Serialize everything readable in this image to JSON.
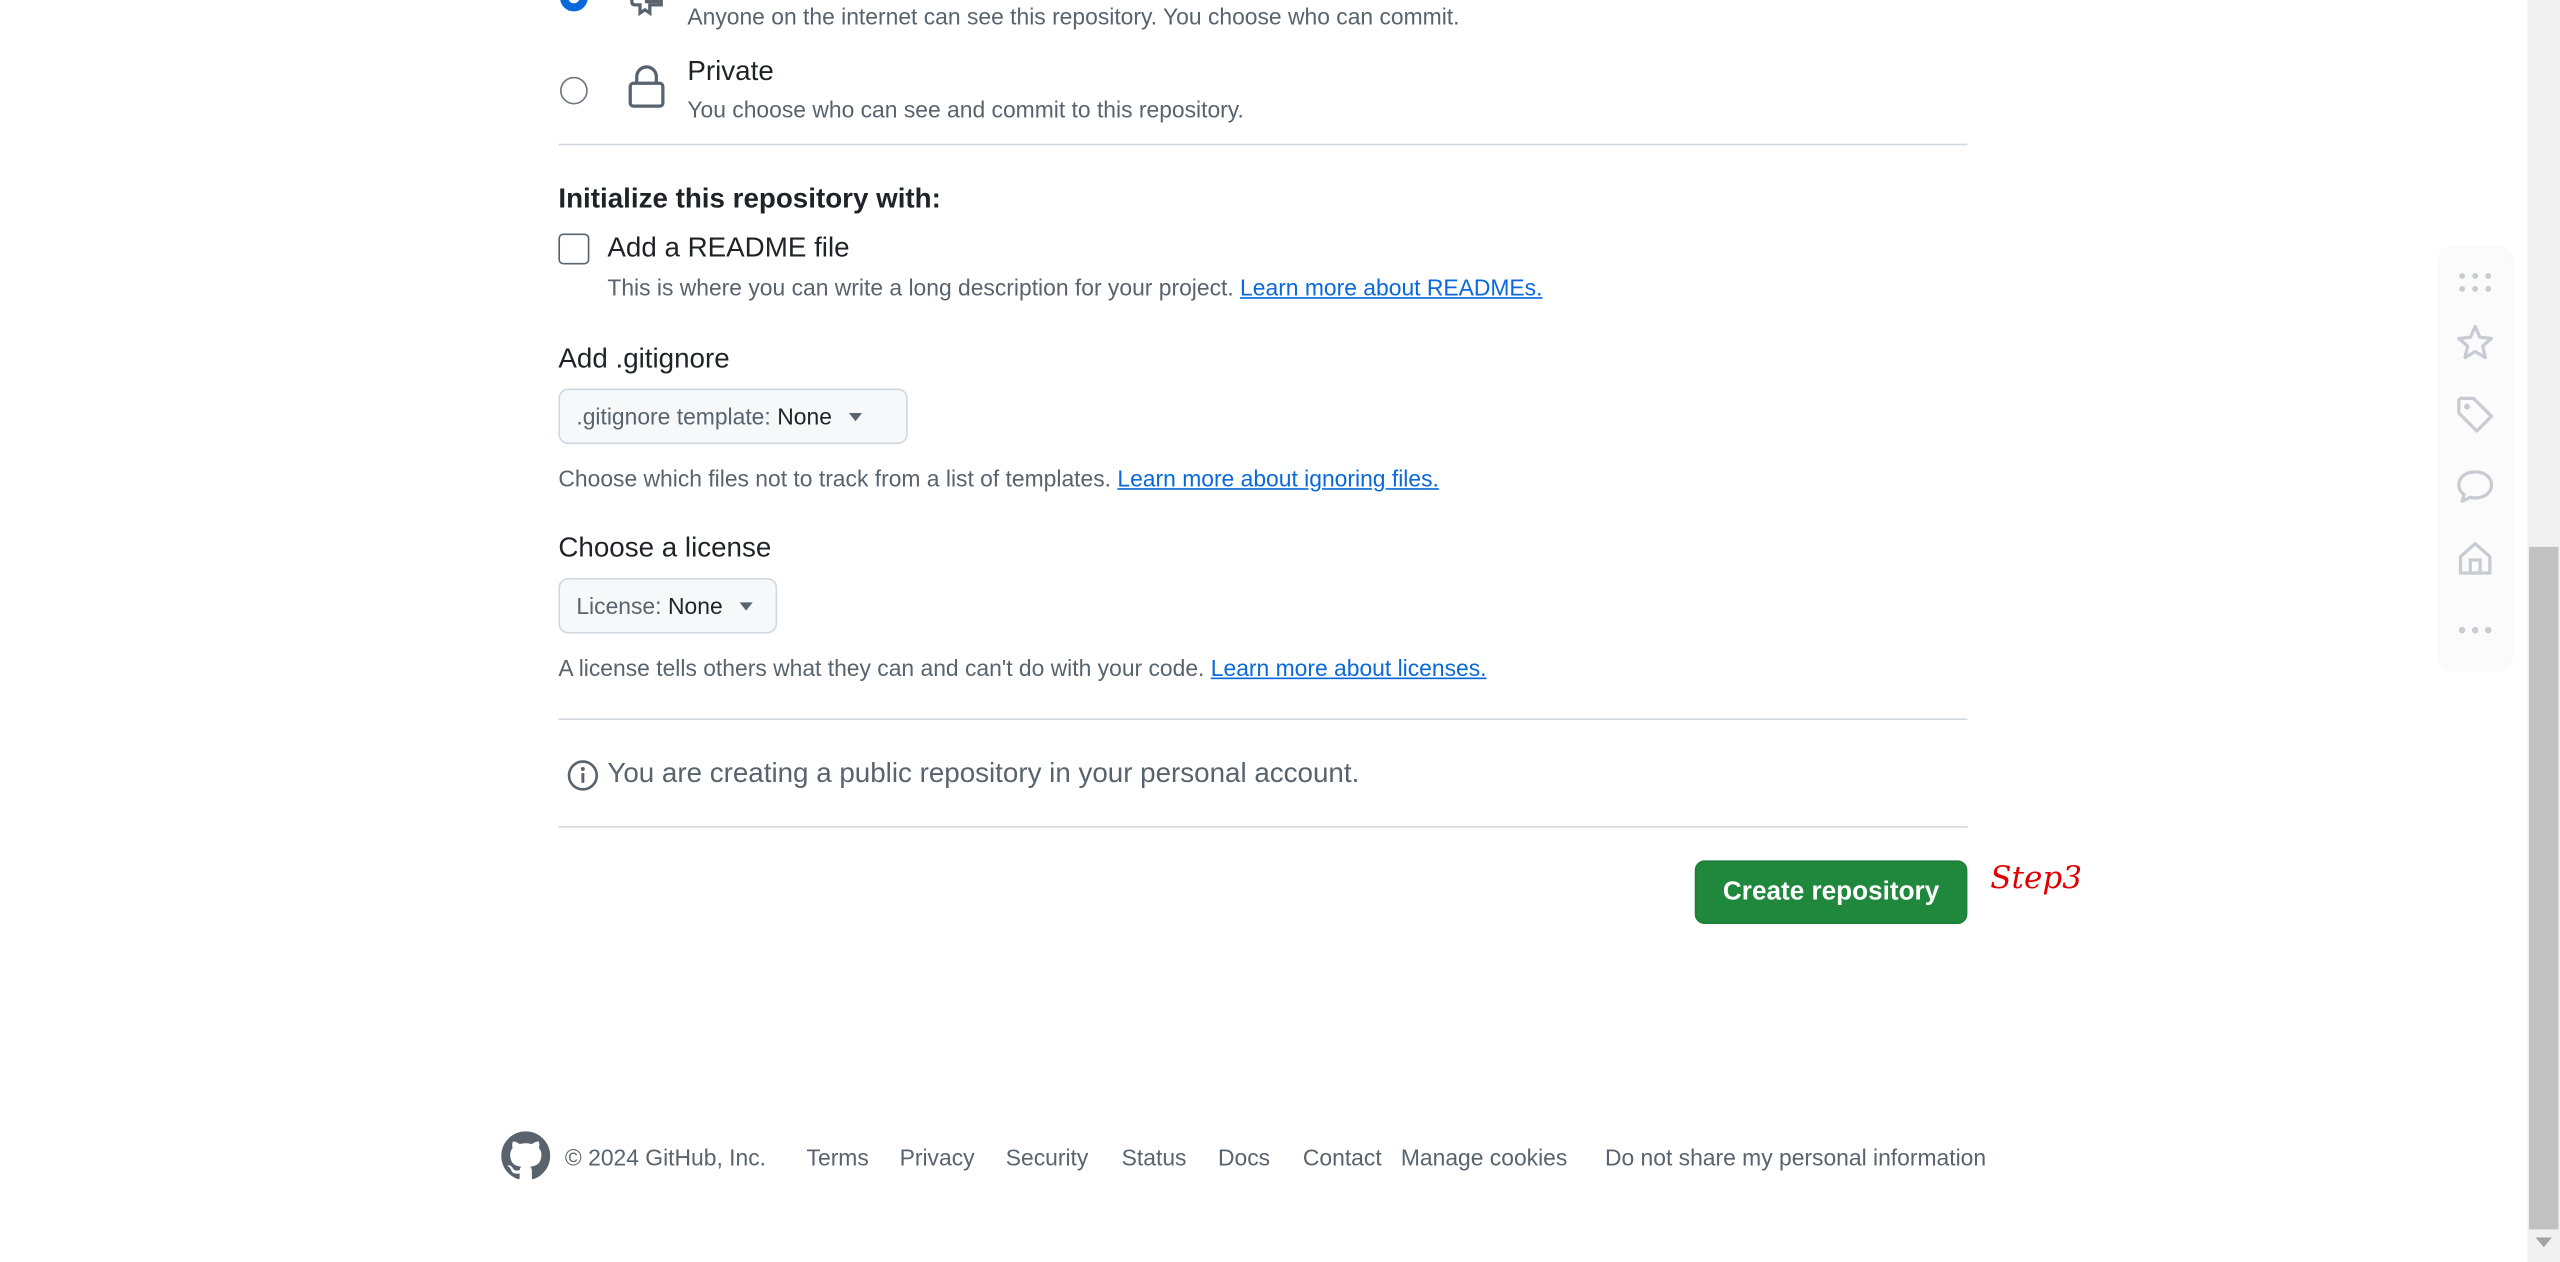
{
  "visibility": {
    "public": {
      "description": "Anyone on the internet can see this repository. You choose who can commit.",
      "selected": true
    },
    "private": {
      "label": "Private",
      "description": "You choose who can see and commit to this repository.",
      "selected": false
    }
  },
  "initialize": {
    "heading": "Initialize this repository with:",
    "readme": {
      "label": "Add a README file",
      "checked": false,
      "help": "This is where you can write a long description for your project.",
      "link": "Learn more about READMEs."
    }
  },
  "gitignore": {
    "heading": "Add .gitignore",
    "select_label": ".gitignore template:",
    "select_value": "None",
    "help": "Choose which files not to track from a list of templates.",
    "link": "Learn more about ignoring files."
  },
  "license": {
    "heading": "Choose a license",
    "select_label": "License:",
    "select_value": "None",
    "help": "A license tells others what they can and can't do with your code.",
    "link": "Learn more about licenses."
  },
  "notice": {
    "text": "You are creating a public repository in your personal account."
  },
  "actions": {
    "create_label": "Create repository",
    "annotation": "Step3"
  },
  "footer": {
    "copyright": "© 2024 GitHub, Inc.",
    "links": [
      "Terms",
      "Privacy",
      "Security",
      "Status",
      "Docs",
      "Contact",
      "Manage cookies",
      "Do not share my personal information"
    ]
  },
  "side_rail": {
    "icons": [
      "grip-dots-icon",
      "star-icon",
      "tag-icon",
      "comment-icon",
      "home-icon",
      "more-icon"
    ]
  },
  "colors": {
    "accent": "#0969da",
    "primary_button": "#1f883d",
    "annotation": "#e00000"
  }
}
